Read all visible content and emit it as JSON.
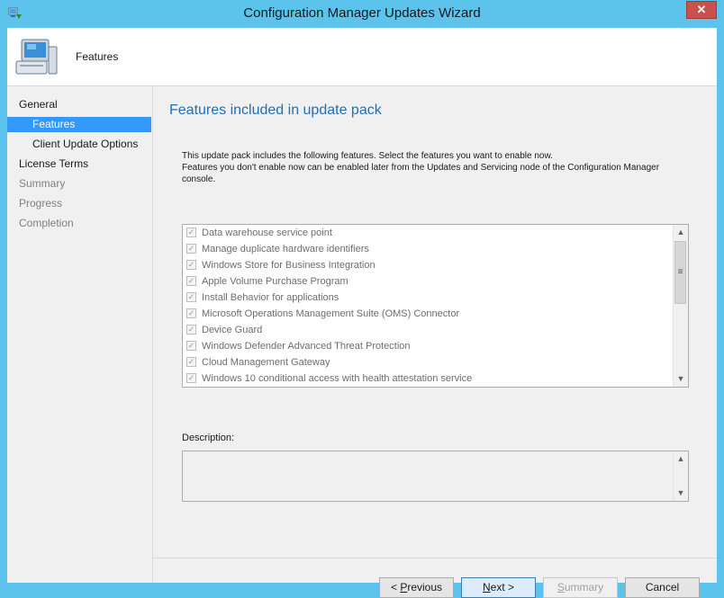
{
  "window": {
    "title": "Configuration Manager Updates Wizard",
    "close_label": "✕"
  },
  "header": {
    "title": "Features"
  },
  "nav": [
    {
      "label": "General",
      "indent": false,
      "state": "normal"
    },
    {
      "label": "Features",
      "indent": true,
      "state": "selected"
    },
    {
      "label": "Client Update Options",
      "indent": true,
      "state": "normal"
    },
    {
      "label": "License Terms",
      "indent": false,
      "state": "normal"
    },
    {
      "label": "Summary",
      "indent": false,
      "state": "disabled"
    },
    {
      "label": "Progress",
      "indent": false,
      "state": "disabled"
    },
    {
      "label": "Completion",
      "indent": false,
      "state": "disabled"
    }
  ],
  "main": {
    "title": "Features included in update pack",
    "intro_line1": "This update pack includes the following features. Select the features you want to enable now.",
    "intro_line2": "Features you don't enable now can be enabled later from the Updates and Servicing node of the Configuration Manager console.",
    "features": [
      {
        "label": "Data warehouse service point",
        "checked": true
      },
      {
        "label": "Manage duplicate hardware identifiers",
        "checked": true
      },
      {
        "label": "Windows Store for Business Integration",
        "checked": true
      },
      {
        "label": "Apple Volume Purchase Program",
        "checked": true
      },
      {
        "label": "Install Behavior for applications",
        "checked": true
      },
      {
        "label": "Microsoft Operations Management Suite (OMS) Connector",
        "checked": true
      },
      {
        "label": "Device Guard",
        "checked": true
      },
      {
        "label": "Windows Defender Advanced Threat Protection",
        "checked": true
      },
      {
        "label": "Cloud Management Gateway",
        "checked": true
      },
      {
        "label": "Windows 10 conditional access with health attestation service",
        "checked": true
      }
    ],
    "description_label": "Description:"
  },
  "buttons": {
    "previous_prefix": "< ",
    "previous_accel": "P",
    "previous_rest": "revious",
    "next_accel": "N",
    "next_rest": "ext >",
    "summary_accel": "S",
    "summary_rest": "ummary",
    "cancel": "Cancel"
  },
  "colors": {
    "titlebar": "#5bc3ec",
    "selection": "#3399ff",
    "heading": "#1e6fb8",
    "close": "#c7514c"
  }
}
